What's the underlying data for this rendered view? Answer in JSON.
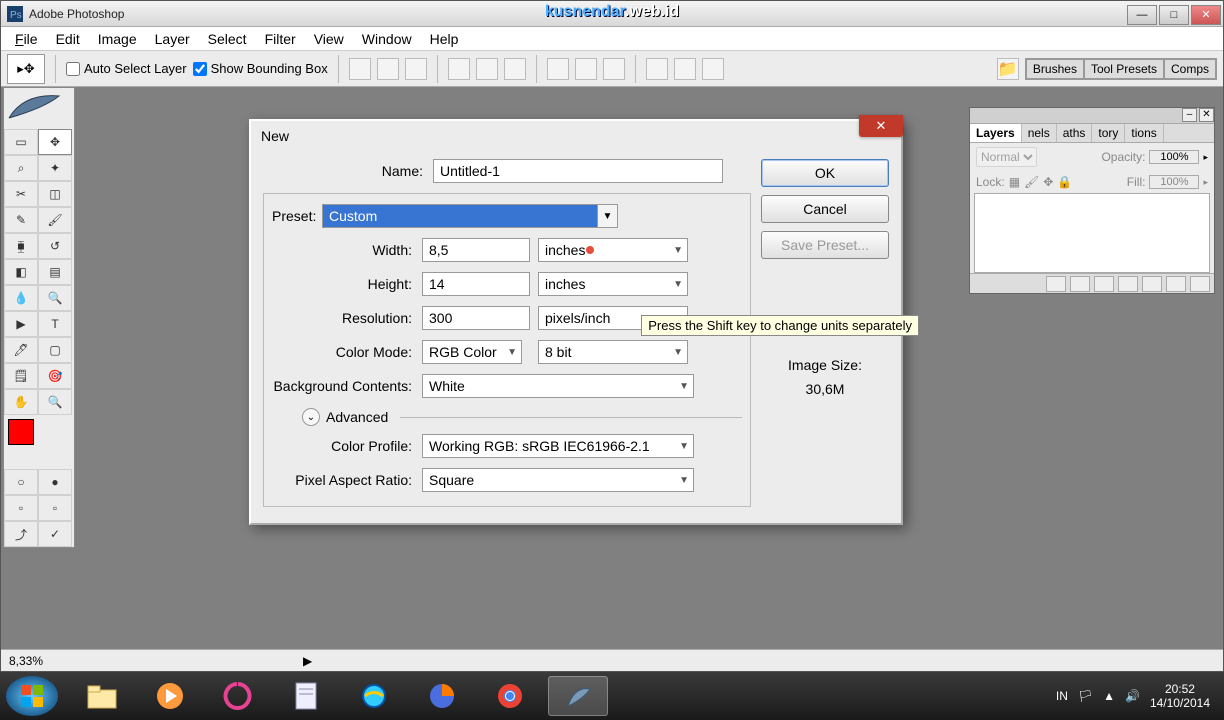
{
  "app": {
    "title": "Adobe Photoshop",
    "watermark_1": "kusnendar",
    "watermark_2": ".web.id"
  },
  "menu": {
    "file": "File",
    "edit": "Edit",
    "image": "Image",
    "layer": "Layer",
    "select": "Select",
    "filter": "Filter",
    "view": "View",
    "window": "Window",
    "help": "Help"
  },
  "options": {
    "auto_select": "Auto Select Layer",
    "show_bb": "Show Bounding Box",
    "auto_checked": false,
    "bb_checked": true,
    "tabs": {
      "brushes": "Brushes",
      "tool_presets": "Tool Presets",
      "comps": "Comps"
    }
  },
  "dialog": {
    "title": "New",
    "name_label": "Name:",
    "name_value": "Untitled-1",
    "preset_label": "Preset:",
    "preset_value": "Custom",
    "width_label": "Width:",
    "width_value": "8,5",
    "width_unit": "inches",
    "height_label": "Height:",
    "height_value": "14",
    "height_unit": "inches",
    "res_label": "Resolution:",
    "res_value": "300",
    "res_unit": "pixels/inch",
    "cmode_label": "Color Mode:",
    "cmode_value": "RGB Color",
    "cdepth_value": "8 bit",
    "bg_label": "Background Contents:",
    "bg_value": "White",
    "advanced": "Advanced",
    "profile_label": "Color Profile:",
    "profile_value": "Working RGB: sRGB IEC61966-2.1",
    "par_label": "Pixel Aspect Ratio:",
    "par_value": "Square",
    "btn_ok": "OK",
    "btn_cancel": "Cancel",
    "btn_save": "Save Preset...",
    "size_label": "Image Size:",
    "size_value": "30,6M",
    "tooltip": "Press the Shift key to change units separately"
  },
  "layersPanel": {
    "tabs": {
      "layers": "Layers",
      "channels": "nels",
      "paths": "aths",
      "history": "tory",
      "actions": "tions"
    },
    "blend": "Normal",
    "opacity_label": "Opacity:",
    "opacity": "100%",
    "lock_label": "Lock:",
    "fill_label": "Fill:",
    "fill": "100%"
  },
  "status": {
    "zoom": "8,33%"
  },
  "taskbar": {
    "lang": "IN",
    "time": "20:52",
    "date": "14/10/2014"
  },
  "colors": {
    "fg": "#ff0000",
    "bg": "#ffffff"
  }
}
